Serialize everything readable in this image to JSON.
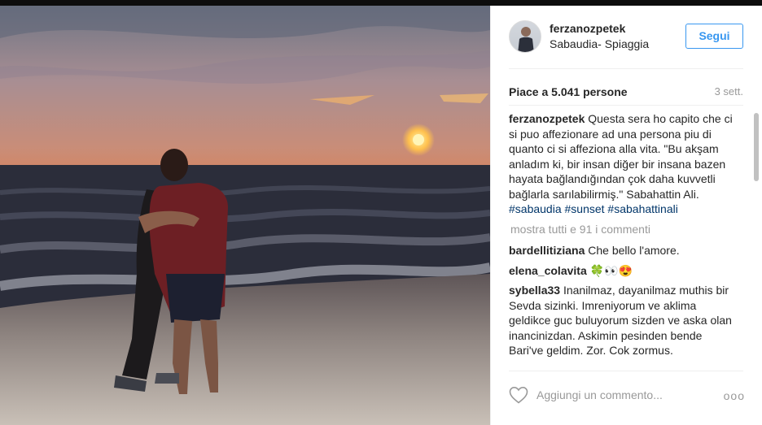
{
  "post": {
    "username": "ferzanozpetek",
    "location": "Sabaudia- Spiaggia",
    "follow_label": "Segui",
    "likes": "Piace a 5.041 persone",
    "time": "3 sett.",
    "caption": {
      "username": "ferzanozpetek",
      "text": "Questa sera ho capito che ci si puo affezionare ad una persona piu di quanto ci si affeziona alla vita. \"Bu akşam anladım ki, bir insan diğer bir insana bazen hayata bağlandığından çok daha kuvvetli bağlarla sarılabilirmiş.\" Sabahattin Ali.",
      "hashtags": "#sabaudia #sunset #sabahattinali"
    },
    "show_all_comments": "mostra tutti e 91 i commenti",
    "comments": [
      {
        "username": "bardellitiziana",
        "text": "Che bello l'amore."
      },
      {
        "username": "elena_colavita",
        "text": "🍀👀😍"
      },
      {
        "username": "sybella33",
        "text": "Inanilmaz, dayanilmaz muthis bir Sevda sizinki. Imreniyorum ve aklima geldikce guc buluyorum sizden ve aska olan inancinizdan. Askimin pesinden bende Bari've geldim. Zor. Cok zormus."
      }
    ],
    "add_comment_placeholder": "Aggiungi un commento...",
    "more_options": "ooo"
  },
  "icons": {
    "like": "heart-outline-icon",
    "more": "more-options-icon"
  },
  "colors": {
    "accent": "#3897f0",
    "hashtag": "#003569",
    "muted": "#999999"
  }
}
